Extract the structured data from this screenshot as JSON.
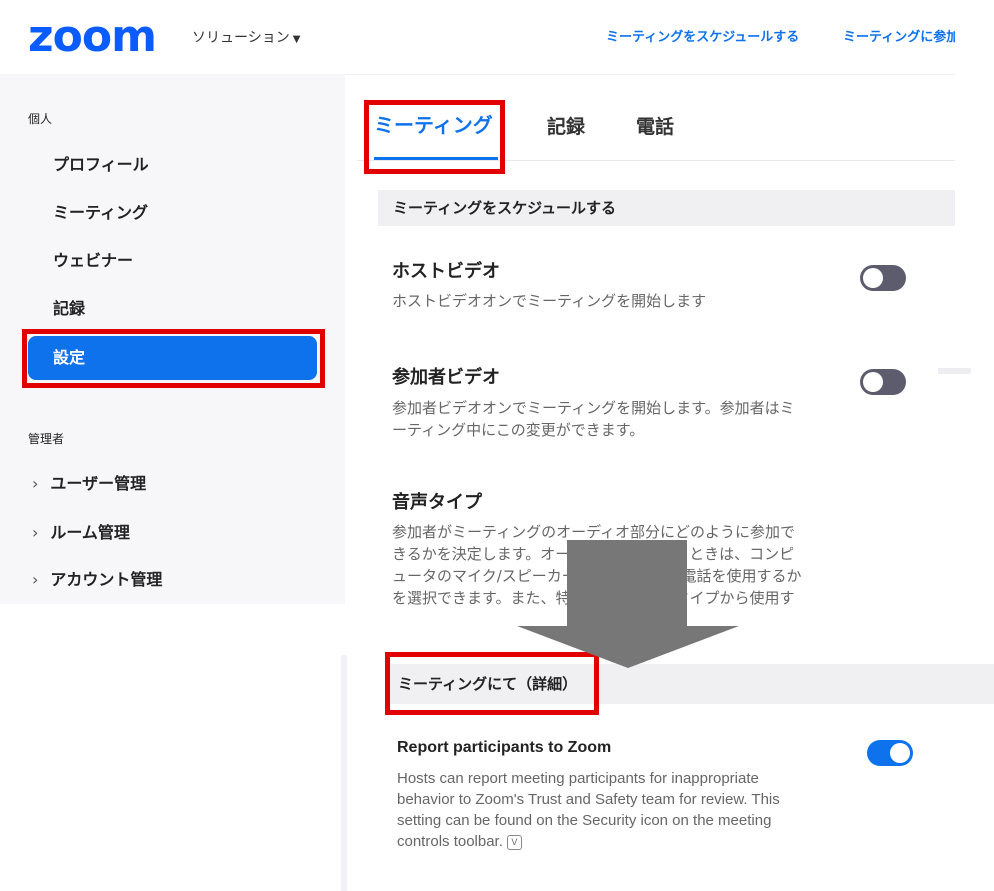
{
  "header": {
    "logo": "zoom",
    "solutions_label": "ソリューション",
    "nav_schedule": "ミーティングをスケジュールする",
    "nav_join": "ミーティングに参加する"
  },
  "sidebar": {
    "personal_label": "個人",
    "items": [
      {
        "label": "プロフィール"
      },
      {
        "label": "ミーティング"
      },
      {
        "label": "ウェビナー"
      },
      {
        "label": "記録"
      },
      {
        "label": "設定",
        "active": true
      }
    ],
    "admin_label": "管理者",
    "admin_items": [
      {
        "label": "ユーザー管理"
      },
      {
        "label": "ルーム管理"
      },
      {
        "label": "アカウント管理"
      }
    ]
  },
  "tabs": [
    {
      "label": "ミーティング",
      "active": true
    },
    {
      "label": "記録"
    },
    {
      "label": "電話"
    }
  ],
  "schedule_section": {
    "title": "ミーティングをスケジュールする",
    "settings": [
      {
        "title": "ホストビデオ",
        "desc": "ホストビデオオンでミーティングを開始します",
        "enabled": false
      },
      {
        "title": "参加者ビデオ",
        "desc_line1": "参加者ビデオオンでミーティングを開始します。参加者はミ",
        "desc_line2": "ーティング中にこの変更ができます。",
        "enabled": false
      },
      {
        "title": "音声タイプ",
        "desc_lines": [
          "参加者がミーティングのオーディオ部分にどのように参加で",
          "きるかを決定します。オーディオに参加するときは、コンピ",
          "ュータのマイク/スピーカーを使用するか、電話を使用するか",
          "を選択できます。また、特定のオーディオタイプから使用す"
        ]
      }
    ]
  },
  "in_meeting_section": {
    "title": "ミーティングにて（詳細）",
    "report": {
      "title": "Report participants to Zoom",
      "desc": "Hosts can report meeting participants for inappropriate behavior to Zoom's Trust and Safety team for review. This setting can be found on the Security icon on the meeting controls toolbar.",
      "enabled": true,
      "badge": "V"
    }
  },
  "colors": {
    "accent": "#0e72ed",
    "highlight": "#e00000",
    "arrow": "#777777"
  },
  "icons": {
    "caret": "caret-down-icon",
    "chevron": "chevron-right-icon",
    "arrow": "down-arrow-icon",
    "badge": "version-badge-icon"
  }
}
